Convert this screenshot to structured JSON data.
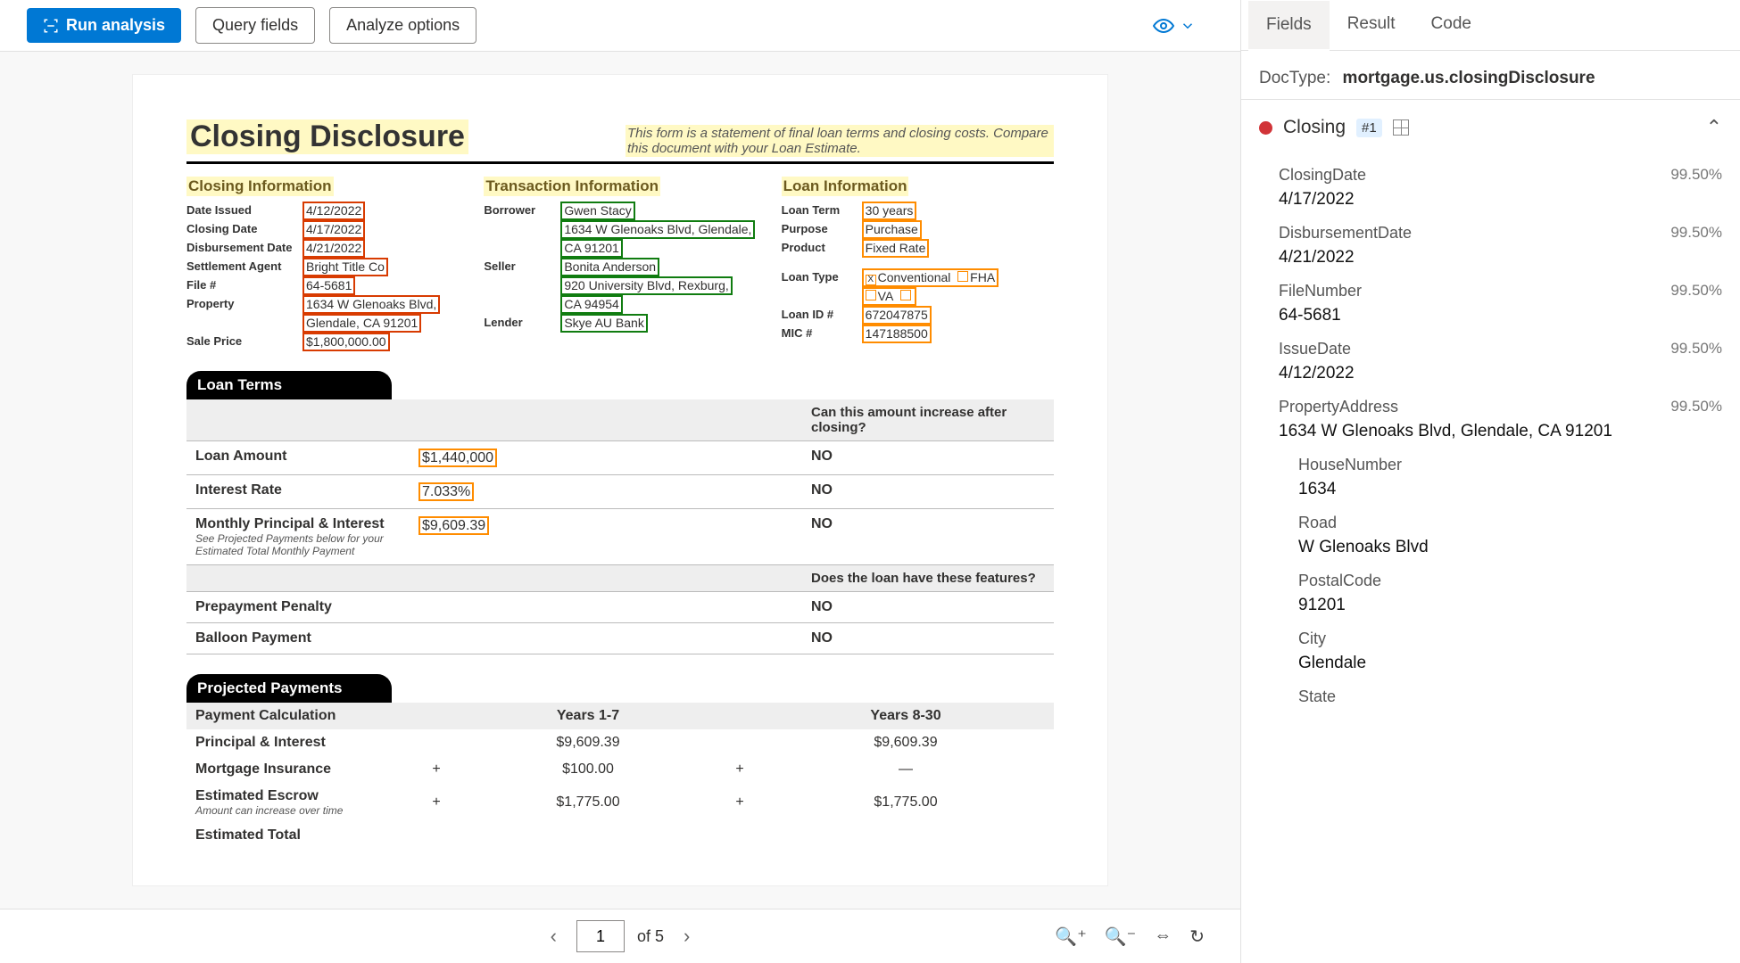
{
  "toolbar": {
    "run": "Run analysis",
    "query": "Query fields",
    "analyze": "Analyze options"
  },
  "document": {
    "title": "Closing Disclosure",
    "blurb": "This form is a statement of final loan terms and closing costs. Compare this document with your Loan Estimate.",
    "closing_info": {
      "header": "Closing  Information",
      "date_issued_label": "Date Issued",
      "date_issued": "4/12/2022",
      "closing_date_label": "Closing Date",
      "closing_date": "4/17/2022",
      "disbursement_label": "Disbursement Date",
      "disbursement": "4/21/2022",
      "settlement_label": "Settlement Agent",
      "settlement": "Bright  Title Co",
      "file_label": "File #",
      "file": "64-5681",
      "property_label": "Property",
      "property_line1": "1634 W Glenoaks Blvd,",
      "property_line2": "Glendale, CA 91201",
      "sale_price_label": "Sale Price",
      "sale_price": "$1,800,000.00"
    },
    "transaction_info": {
      "header": "Transaction  Information",
      "borrower_label": "Borrower",
      "borrower_name": "Gwen Stacy",
      "borrower_addr1": "1634 W Glenoaks Blvd, Glendale,",
      "borrower_addr2": "CA 91201",
      "seller_label": "Seller",
      "seller_name": "Bonita Anderson",
      "seller_addr1": "920 University Blvd, Rexburg,",
      "seller_addr2": "CA 94954",
      "lender_label": "Lender",
      "lender": "Skye AU Bank"
    },
    "loan_info": {
      "header": "Loan  Information",
      "term_label": "Loan Term",
      "term": "30 years",
      "purpose_label": "Purpose",
      "purpose": "Purchase",
      "product_label": "Product",
      "product": "Fixed Rate",
      "type_label": "Loan Type",
      "type_conventional": "Conventional",
      "type_fha": "FHA",
      "type_va": "VA",
      "loan_id_label": "Loan ID #",
      "loan_id": "672047875",
      "mic_label": "MIC #",
      "mic": "147188500"
    },
    "loan_terms": {
      "header": "Loan Terms",
      "q1": "Can this amount increase after closing?",
      "loan_amount_label": "Loan Amount",
      "loan_amount": "$1,440,000",
      "loan_amount_ans": "NO",
      "rate_label": "Interest Rate",
      "rate": "7.033%",
      "rate_ans": "NO",
      "pi_label": "Monthly Principal & Interest",
      "pi": "$9,609.39",
      "pi_ans": "NO",
      "pi_note": "See Projected Payments below for your Estimated Total Monthly Payment",
      "q2": "Does the loan have these features?",
      "prepay_label": "Prepayment Penalty",
      "prepay_ans": "NO",
      "balloon_label": "Balloon Payment",
      "balloon_ans": "NO"
    },
    "projected": {
      "header": "Projected Payments",
      "calc_label": "Payment Calculation",
      "col1": "Years 1-7",
      "col2": "Years 8-30",
      "rows": [
        {
          "label": "Principal & Interest",
          "plus1": "",
          "v1": "$9,609.39",
          "plus2": "",
          "v2": "$9,609.39"
        },
        {
          "label": "Mortgage Insurance",
          "plus1": "+",
          "v1": "$100.00",
          "plus2": "+",
          "v2": "—"
        },
        {
          "label": "Estimated Escrow",
          "plus1": "+",
          "v1": "$1,775.00",
          "plus2": "+",
          "v2": "$1,775.00",
          "note": "Amount can increase over time"
        },
        {
          "label": "Estimated Total",
          "plus1": "",
          "v1": "",
          "plus2": "",
          "v2": ""
        }
      ]
    }
  },
  "pager": {
    "page": "1",
    "of": "of 5"
  },
  "right": {
    "tabs": {
      "fields": "Fields",
      "result": "Result",
      "code": "Code"
    },
    "doctype_label": "DocType:",
    "doctype": "mortgage.us.closingDisclosure",
    "section": {
      "name": "Closing",
      "badge": "#1"
    },
    "fields": [
      {
        "name": "ClosingDate",
        "conf": "99.50%",
        "value": "4/17/2022"
      },
      {
        "name": "DisbursementDate",
        "conf": "99.50%",
        "value": "4/21/2022"
      },
      {
        "name": "FileNumber",
        "conf": "99.50%",
        "value": "64-5681"
      },
      {
        "name": "IssueDate",
        "conf": "99.50%",
        "value": "4/12/2022"
      },
      {
        "name": "PropertyAddress",
        "conf": "99.50%",
        "value": "1634 W Glenoaks Blvd, Glendale, CA 91201"
      }
    ],
    "subfields": [
      {
        "name": "HouseNumber",
        "value": "1634"
      },
      {
        "name": "Road",
        "value": "W Glenoaks Blvd"
      },
      {
        "name": "PostalCode",
        "value": "91201"
      },
      {
        "name": "City",
        "value": "Glendale"
      },
      {
        "name": "State",
        "value": ""
      }
    ]
  }
}
